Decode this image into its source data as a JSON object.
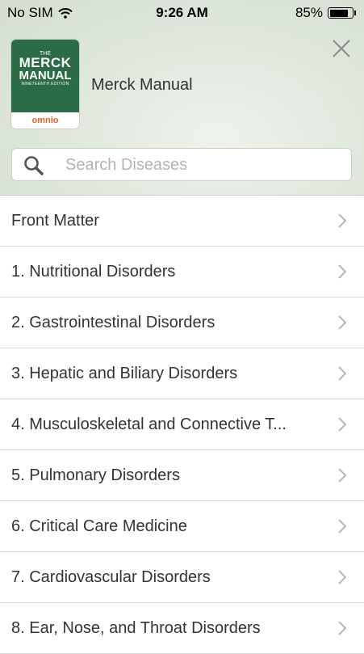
{
  "status_bar": {
    "carrier": "No SIM",
    "time": "9:26 AM",
    "battery_percent": "85%",
    "battery_level": 0.85
  },
  "header": {
    "logo": {
      "the": "THE",
      "merck": "MERCK",
      "manual": "MANUAL",
      "edition": "NINETEENTH EDITION",
      "brand": "omnio"
    },
    "app_title": "Merck Manual",
    "close_icon": "close-icon"
  },
  "search": {
    "placeholder": "Search Diseases",
    "value": ""
  },
  "chapters": [
    {
      "label": "Front Matter"
    },
    {
      "label": "1. Nutritional Disorders"
    },
    {
      "label": "2. Gastrointestinal Disorders"
    },
    {
      "label": "3. Hepatic and Biliary Disorders"
    },
    {
      "label": "4. Musculoskeletal and Connective T..."
    },
    {
      "label": "5. Pulmonary Disorders"
    },
    {
      "label": "6. Critical Care Medicine"
    },
    {
      "label": "7. Cardiovascular Disorders"
    },
    {
      "label": "8. Ear, Nose, and Throat Disorders"
    }
  ],
  "colors": {
    "header_bg": "#dde6da",
    "logo_green": "#2b6b45",
    "logo_orange": "#e8632a",
    "text": "#333333",
    "divider": "#d9d9d9"
  }
}
